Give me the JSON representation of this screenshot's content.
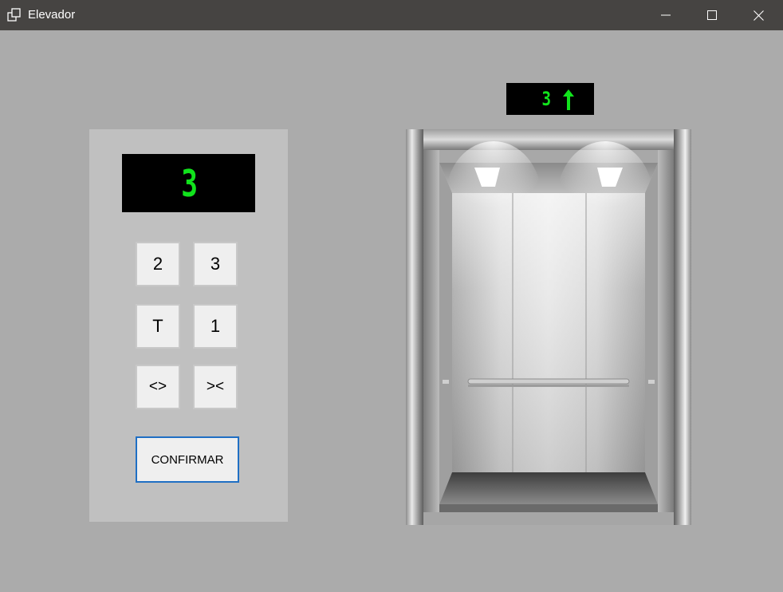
{
  "window": {
    "title": "Elevador",
    "controls": {
      "minimize": "minimize-icon",
      "maximize": "maximize-icon",
      "close": "close-icon"
    }
  },
  "panel": {
    "display_value": "3",
    "buttons": {
      "floor_2": "2",
      "floor_3": "3",
      "floor_t": "T",
      "floor_1": "1",
      "open_doors": "<>",
      "close_doors": "><"
    },
    "confirm_label": "CONFIRMAR"
  },
  "indicator": {
    "floor": "3",
    "direction": "up",
    "direction_icon": "up-arrow-icon"
  },
  "colors": {
    "display_green": "#11e31c",
    "background": "#ababab",
    "panel": "#c0c0c0",
    "titlebar": "#464442",
    "confirm_border": "#1f6fc4"
  }
}
